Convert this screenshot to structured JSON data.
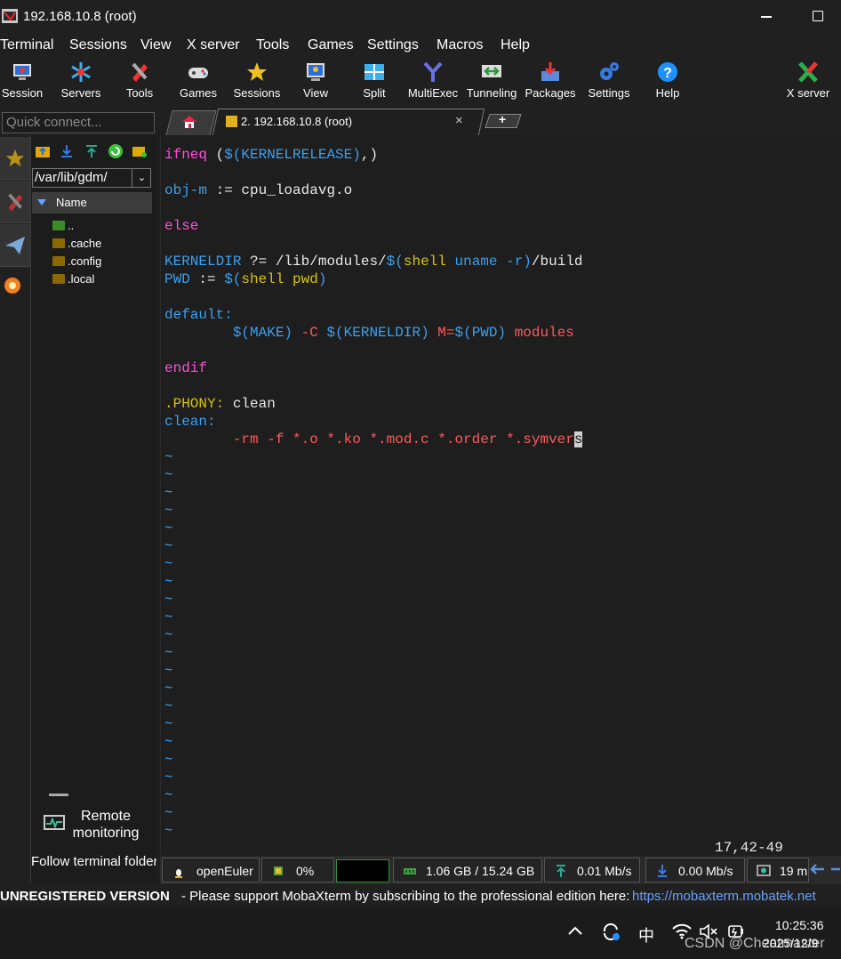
{
  "window": {
    "title": "192.168.10.8 (root)"
  },
  "menu": [
    "Terminal",
    "Sessions",
    "View",
    "X server",
    "Tools",
    "Games",
    "Settings",
    "Macros",
    "Help"
  ],
  "toolbar": [
    {
      "label": "Session",
      "icon": "session-icon"
    },
    {
      "label": "Servers",
      "icon": "servers-icon"
    },
    {
      "label": "Tools",
      "icon": "tools-icon"
    },
    {
      "label": "Games",
      "icon": "gamepad-icon"
    },
    {
      "label": "Sessions",
      "icon": "star-icon"
    },
    {
      "label": "View",
      "icon": "view-icon"
    },
    {
      "label": "Split",
      "icon": "split-icon"
    },
    {
      "label": "MultiExec",
      "icon": "multiexec-icon"
    },
    {
      "label": "Tunneling",
      "icon": "tunneling-icon"
    },
    {
      "label": "Packages",
      "icon": "packages-icon"
    },
    {
      "label": "Settings",
      "icon": "gears-icon"
    },
    {
      "label": "Help",
      "icon": "help-icon"
    },
    {
      "label": "X server",
      "icon": "x-server-icon"
    }
  ],
  "quick_connect": {
    "placeholder": "Quick connect..."
  },
  "tabs": {
    "session_label": "2. 192.168.10.8 (root)",
    "close": "×",
    "new": "+"
  },
  "sidebar": {
    "path": "/var/lib/gdm/",
    "dropdown": "⌄",
    "column": "Name",
    "items": [
      "..",
      ".cache",
      ".config",
      ".local"
    ],
    "remote_monitoring": "Remote monitoring",
    "follow": "Follow terminal folder"
  },
  "terminal": {
    "lines": [
      [
        {
          "t": "ifneq",
          "c": "mag"
        },
        {
          "t": " (",
          "c": "white"
        },
        {
          "t": "$(KERNELRELEASE)",
          "c": "cyan"
        },
        {
          "t": ",)",
          "c": "white"
        }
      ],
      [],
      [
        {
          "t": "obj-m",
          "c": "cyan"
        },
        {
          "t": " := cpu_loadavg.o",
          "c": "white"
        }
      ],
      [],
      [
        {
          "t": "else",
          "c": "mag"
        }
      ],
      [],
      [
        {
          "t": "KERNELDIR",
          "c": "cyan"
        },
        {
          "t": " ?= /lib/modules/",
          "c": "white"
        },
        {
          "t": "$(",
          "c": "cyan"
        },
        {
          "t": "shell",
          "c": "yel"
        },
        {
          "t": " ",
          "c": "white"
        },
        {
          "t": "uname -r",
          "c": "cyan"
        },
        {
          "t": ")",
          "c": "cyan"
        },
        {
          "t": "/build",
          "c": "white"
        }
      ],
      [
        {
          "t": "PWD",
          "c": "cyan"
        },
        {
          "t": " := ",
          "c": "white"
        },
        {
          "t": "$(",
          "c": "cyan"
        },
        {
          "t": "shell",
          "c": "yel"
        },
        {
          "t": " ",
          "c": "white"
        },
        {
          "t": "pwd",
          "c": "yel"
        },
        {
          "t": ")",
          "c": "cyan"
        }
      ],
      [],
      [
        {
          "t": "default:",
          "c": "cyan"
        }
      ],
      [
        {
          "t": "        ",
          "c": "white"
        },
        {
          "t": "$(MAKE)",
          "c": "cyan"
        },
        {
          "t": " ",
          "c": "white"
        },
        {
          "t": "-C",
          "c": "red"
        },
        {
          "t": " ",
          "c": "white"
        },
        {
          "t": "$(KERNELDIR)",
          "c": "cyan"
        },
        {
          "t": " ",
          "c": "white"
        },
        {
          "t": "M=",
          "c": "red"
        },
        {
          "t": "$(PWD)",
          "c": "cyan"
        },
        {
          "t": " modules",
          "c": "red"
        }
      ],
      [],
      [
        {
          "t": "endif",
          "c": "mag"
        }
      ],
      [],
      [
        {
          "t": ".PHONY:",
          "c": "yel"
        },
        {
          "t": " clean",
          "c": "white"
        }
      ],
      [
        {
          "t": "clean:",
          "c": "cyan"
        }
      ],
      [
        {
          "t": "        ",
          "c": "white"
        },
        {
          "t": "-rm -f *.o *.ko *.mod.c *.order *.symver",
          "c": "red"
        },
        {
          "t": "s",
          "c": "cursor"
        }
      ]
    ],
    "tilde_count": 22,
    "tilde": "~",
    "ruler": "17,42-49"
  },
  "status": {
    "os": "openEuler",
    "cpu": "0%",
    "memory": "1.06 GB / 15.24 GB",
    "upload": "0.01 Mb/s",
    "download": "0.00 Mb/s",
    "time": "19 m"
  },
  "banner": {
    "bold": "UNREGISTERED VERSION",
    "message": "-  Please support MobaXterm by subscribing to the professional edition here:",
    "url": "https://mobaxterm.mobatek.net"
  },
  "taskbar": {
    "ime": "中",
    "time": "10:25:36",
    "date": "2025/12/9"
  },
  "watermark": "CSDN @Cheatmaster",
  "colors": {
    "accent": "#3aa0f0",
    "magenta": "#ff4fd8",
    "yellow": "#d7c400",
    "red": "#ff5a5a"
  }
}
